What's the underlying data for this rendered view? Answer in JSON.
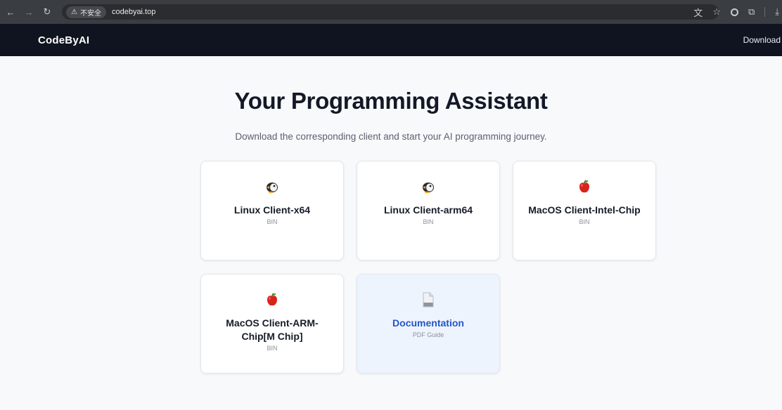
{
  "browser": {
    "security_label": "不安全",
    "url": "codebyai.top",
    "back_icon": "arrow-left-icon",
    "forward_icon": "arrow-right-icon",
    "reload_icon": "reload-icon"
  },
  "header": {
    "brand": "CodeByAI",
    "nav_download": "Download"
  },
  "hero": {
    "title": "Your Programming Assistant",
    "subtitle": "Download the corresponding client and start your AI programming journey."
  },
  "cards": [
    {
      "title": "Linux Client-x64",
      "kind": "BIN",
      "icon": "penguin-icon"
    },
    {
      "title": "Linux Client-arm64",
      "kind": "BIN",
      "icon": "penguin-icon"
    },
    {
      "title": "MacOS Client-Intel-Chip",
      "kind": "BIN",
      "icon": "apple-icon"
    },
    {
      "title": "MacOS Client-ARM-Chip[M Chip]",
      "kind": "BIN",
      "icon": "apple-icon"
    },
    {
      "title": "Documentation",
      "kind": "PDF Guide",
      "icon": "document-icon"
    }
  ],
  "colors": {
    "header_bg": "#0f1420",
    "accent": "#2455c9",
    "doc_card_bg": "#eef4fd"
  }
}
